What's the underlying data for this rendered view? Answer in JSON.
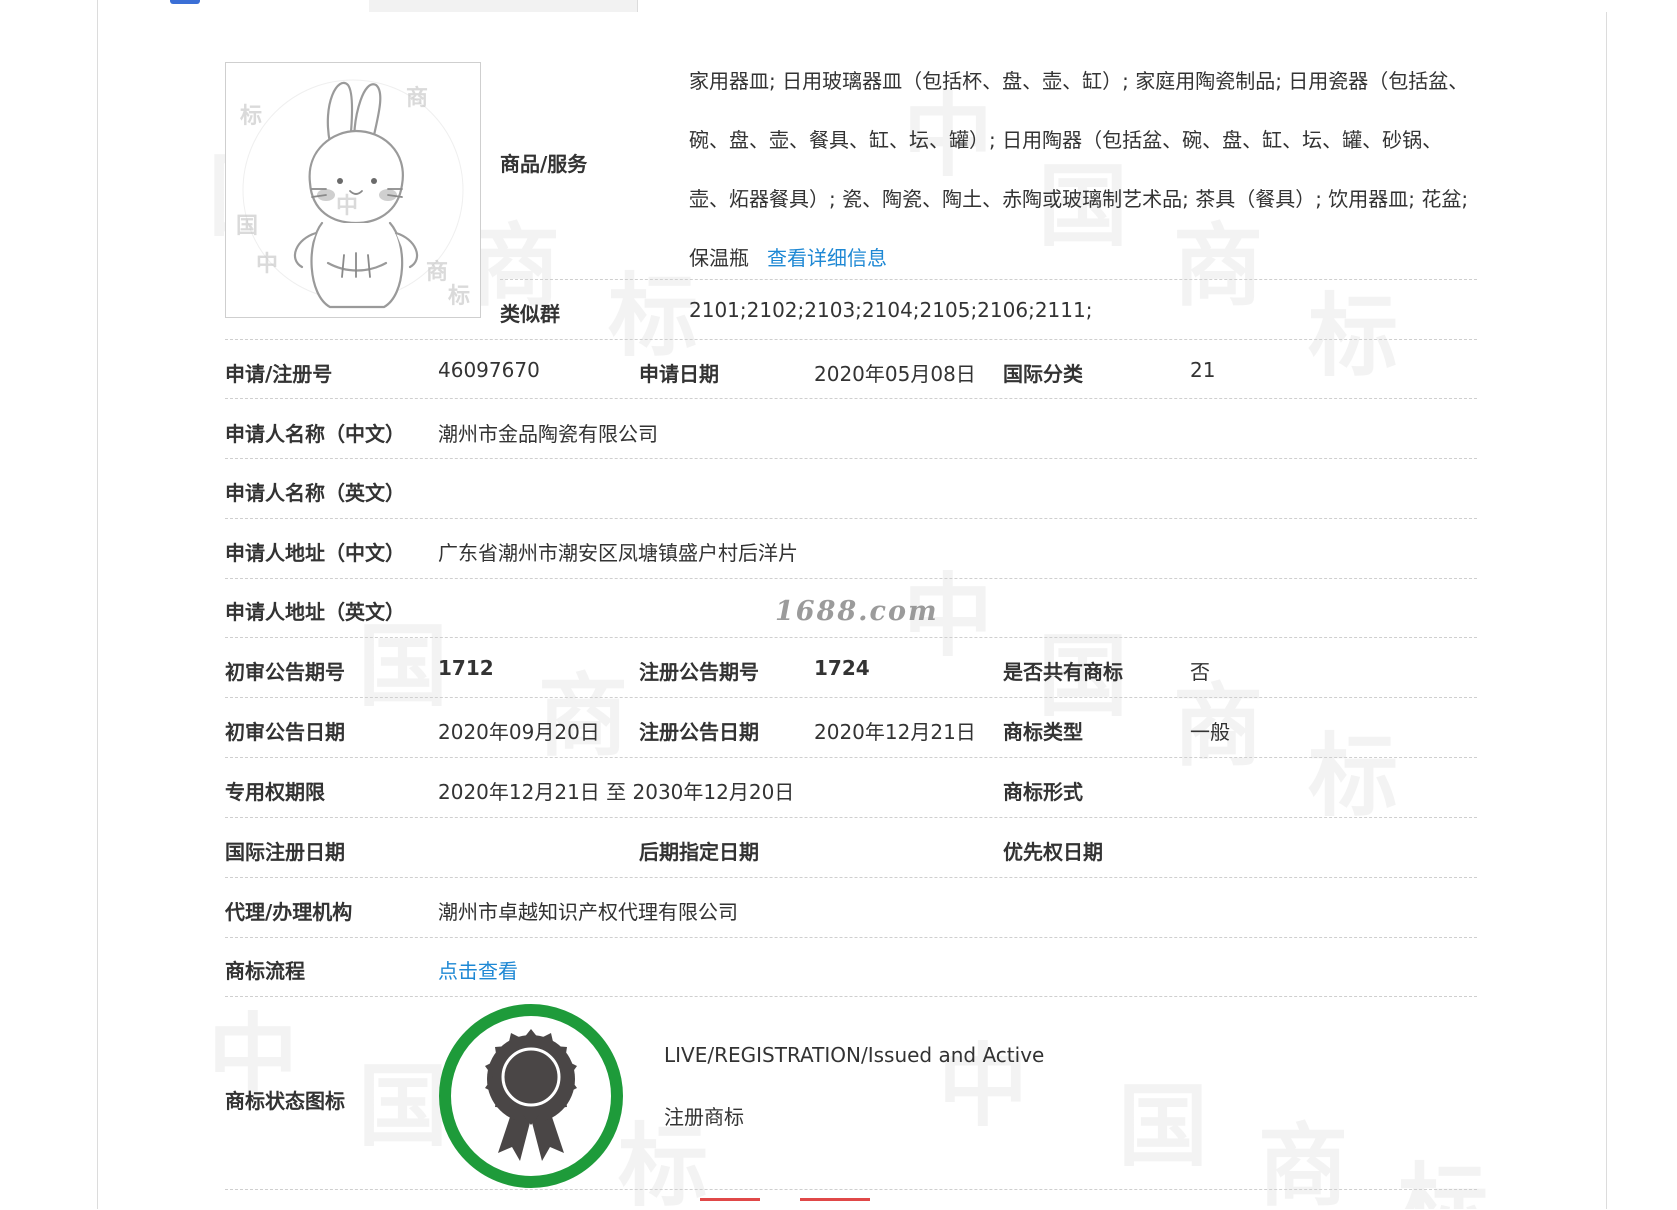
{
  "watermark": {
    "site": "1688.com",
    "glyphs": [
      "中",
      "国",
      "商",
      "标"
    ]
  },
  "trademark_image": {
    "description_icon": "rabbit-trademark-image"
  },
  "goods_services": {
    "label": "商品/服务",
    "text": "家用器皿; 日用玻璃器皿（包括杯、盘、壶、缸）; 家庭用陶瓷制品; 日用瓷器（包括盆、碗、盘、壶、餐具、缸、坛、罐）; 日用陶器（包括盆、碗、盘、缸、坛、罐、砂锅、壶、炻器餐具）; 瓷、陶瓷、陶土、赤陶或玻璃制艺术品; 茶具（餐具）; 饮用器皿; 花盆; 保温瓶",
    "detail_link": "查看详细信息"
  },
  "similar_group": {
    "label": "类似群",
    "value": "2101;2102;2103;2104;2105;2106;2111;"
  },
  "rows": {
    "reg_no_label": "申请/注册号",
    "reg_no": "46097670",
    "app_date_label": "申请日期",
    "app_date": "2020年05月08日",
    "intl_class_label": "国际分类",
    "intl_class": "21",
    "applicant_cn_label": "申请人名称（中文）",
    "applicant_cn": "潮州市金品陶瓷有限公司",
    "applicant_en_label": "申请人名称（英文）",
    "applicant_en": "",
    "address_cn_label": "申请人地址（中文）",
    "address_cn": "广东省潮州市潮安区凤塘镇盛户村后洋片",
    "address_en_label": "申请人地址（英文）",
    "address_en": "",
    "prelim_no_label": "初审公告期号",
    "prelim_no": "1712",
    "reg_pub_no_label": "注册公告期号",
    "reg_pub_no": "1724",
    "shared_label": "是否共有商标",
    "shared": "否",
    "prelim_date_label": "初审公告日期",
    "prelim_date": "2020年09月20日",
    "reg_pub_date_label": "注册公告日期",
    "reg_pub_date": "2020年12月21日",
    "tm_type_label": "商标类型",
    "tm_type": "一般",
    "exclusive_label": "专用权期限",
    "exclusive": "2020年12月21日 至 2030年12月20日",
    "tm_form_label": "商标形式",
    "tm_form": "",
    "intl_reg_date_label": "国际注册日期",
    "intl_reg_date": "",
    "later_designation_label": "后期指定日期",
    "later_designation": "",
    "priority_date_label": "优先权日期",
    "priority_date": "",
    "agent_label": "代理/办理机构",
    "agent": "潮州市卓越知识产权代理有限公司",
    "flow_label": "商标流程",
    "flow_link": "点击查看",
    "status_label": "商标状态图标",
    "status_en": "LIVE/REGISTRATION/Issued and Active",
    "status_cn": "注册商标"
  },
  "colors": {
    "link": "#1e88d4",
    "status_ring": "#1e9b3a",
    "status_badge": "#4a4646",
    "tab_accent": "#3b6fd6"
  }
}
